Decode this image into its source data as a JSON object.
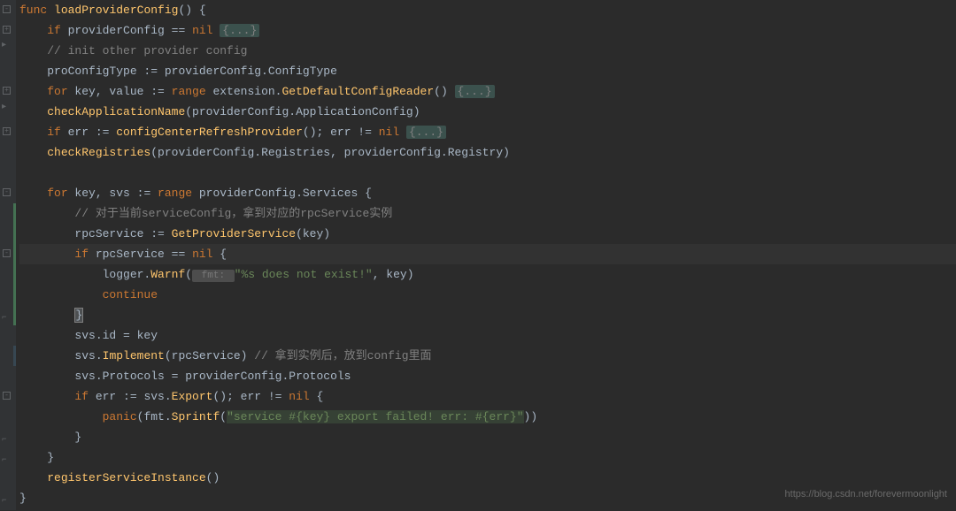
{
  "code": {
    "l1_func": "func",
    "l1_name": "loadProviderConfig",
    "l1_rest": "() {",
    "l2_if": "if",
    "l2_cond": " providerConfig == ",
    "l2_nil": "nil",
    "l2_fold": "{...}",
    "l3_comment": "// init other provider config",
    "l4_var": "proConfigType := providerConfig.ConfigType",
    "l5_for": "for",
    "l5_vars": " key, value := ",
    "l5_range": "range",
    "l5_call": " extension.",
    "l5_fn": "GetDefaultConfigReader",
    "l5_rest": "() ",
    "l5_fold": "{...}",
    "l6_fn": "checkApplicationName",
    "l6_args": "(providerConfig.ApplicationConfig)",
    "l7_if": "if",
    "l7_mid": " err := ",
    "l7_fn": "configCenterRefreshProvider",
    "l7_rest": "(); err != ",
    "l7_nil": "nil",
    "l7_fold": "{...}",
    "l8_fn": "checkRegistries",
    "l8_args": "(providerConfig.Registries, providerConfig.Registry)",
    "l10_for": "for",
    "l10_vars": " key, svs := ",
    "l10_range": "range",
    "l10_rest": " providerConfig.Services {",
    "l11_comment": "// 对于当前serviceConfig，拿到对应的rpcService实例",
    "l12_var": "rpcService := ",
    "l12_fn": "GetProviderService",
    "l12_args": "(key)",
    "l13_if": "if",
    "l13_cond": " rpcService == ",
    "l13_nil": "nil",
    "l13_brace": " {",
    "l14_obj": "logger.",
    "l14_fn": "Warnf",
    "l14_open": "(",
    "l14_hint": " fmt: ",
    "l14_str": "\"%s does not exist!\"",
    "l14_rest": ", key)",
    "l15_continue": "continue",
    "l16_brace": "}",
    "l17_stmt": "svs.id = key",
    "l18_call": "svs.",
    "l18_fn": "Implement",
    "l18_args": "(rpcService) ",
    "l18_comment": "// 拿到实例后，放到config里面",
    "l19_stmt": "svs.Protocols = providerConfig.Protocols",
    "l20_if": "if",
    "l20_mid": " err := svs.",
    "l20_fn": "Export",
    "l20_rest": "(); err != ",
    "l20_nil": "nil",
    "l20_brace": " {",
    "l21_panic": "panic",
    "l21_open": "(fmt.",
    "l21_fn": "Sprintf",
    "l21_open2": "(",
    "l21_str": "\"service #{key} export failed! err: #{err}\"",
    "l21_close": "))",
    "l22_brace": "}",
    "l23_brace": "}",
    "l24_fn": "registerServiceInstance",
    "l24_args": "()",
    "l25_brace": "}"
  },
  "watermark": "https://blog.csdn.net/forevermoonlight"
}
